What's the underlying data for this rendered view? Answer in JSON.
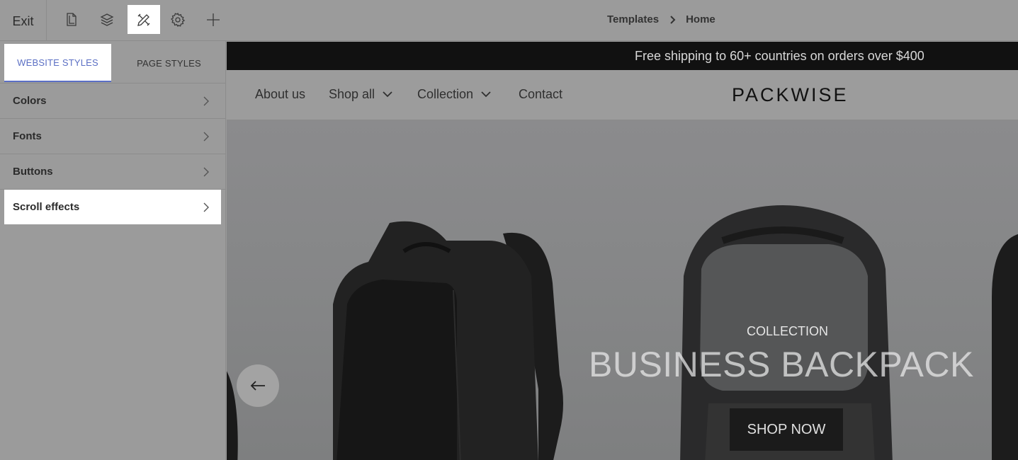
{
  "toolbar": {
    "exit_label": "Exit",
    "tools": [
      {
        "name": "pages-icon",
        "active": false
      },
      {
        "name": "layers-icon",
        "active": false
      },
      {
        "name": "design-tools-icon",
        "active": true
      },
      {
        "name": "gear-icon",
        "active": false
      },
      {
        "name": "plus-icon",
        "active": false
      }
    ],
    "breadcrumb": [
      "Templates",
      "Home"
    ]
  },
  "panel": {
    "tabs": [
      "WEBSITE STYLES",
      "PAGE STYLES"
    ],
    "active_tab": "WEBSITE STYLES",
    "items": [
      {
        "label": "Colors"
      },
      {
        "label": "Fonts"
      },
      {
        "label": "Buttons"
      },
      {
        "label": "Scroll effects",
        "active": true
      }
    ]
  },
  "site": {
    "announcement": "Free shipping to 60+ countries on orders over $400",
    "nav": [
      {
        "label": "About us",
        "dropdown": false
      },
      {
        "label": "Shop all",
        "dropdown": true
      },
      {
        "label": "Collection",
        "dropdown": true
      },
      {
        "label": "Contact",
        "dropdown": false
      }
    ],
    "logo": "PACKWISE",
    "hero": {
      "subtitle": "COLLECTION",
      "title": "BUSINESS BACKPACK",
      "cta": "SHOP NOW"
    }
  },
  "colors": {
    "accent": "#5b6fc4",
    "overlay": "#9b9b9b",
    "announcement_bg": "#111111"
  }
}
